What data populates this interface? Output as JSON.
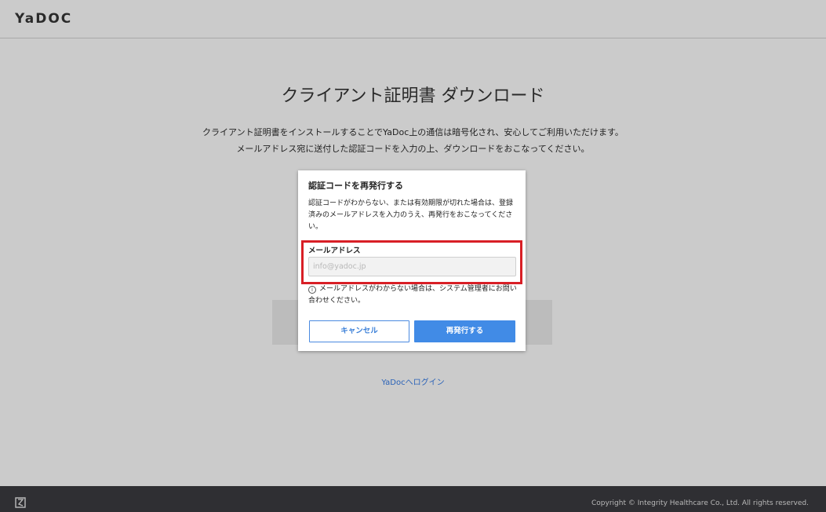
{
  "header": {
    "logo": "YaDOC"
  },
  "main": {
    "title": "クライアント証明書 ダウンロード",
    "description_line1": "クライアント証明書をインストールすることでYaDoc上の通信は暗号化され、安心してご利用いただけます。",
    "description_line2": "メールアドレス宛に送付した認証コードを入力の上、ダウンロードをおこなってください。",
    "login_link": "YaDocへログイン"
  },
  "modal": {
    "title": "認証コードを再発行する",
    "description": "認証コードがわからない、または有効期限が切れた場合は、登録済みのメールアドレスを入力のうえ、再発行をおこなってください。",
    "email_label": "メールアドレス",
    "email_placeholder": "info@yadoc.jp",
    "email_value": "",
    "note": "メールアドレスがわからない場合は、システム管理者にお問い合わせください。",
    "cancel_label": "キャンセル",
    "reissue_label": "再発行する",
    "info_icon": "info-icon"
  },
  "footer": {
    "copyright": "Copyright © Integrity Healthcare Co., Ltd. All rights reserved."
  },
  "colors": {
    "background": "#cbcbcb",
    "primary_button": "#418be6",
    "highlight": "#d81f26",
    "footer": "#2f2f33",
    "link": "#2b63b8"
  }
}
